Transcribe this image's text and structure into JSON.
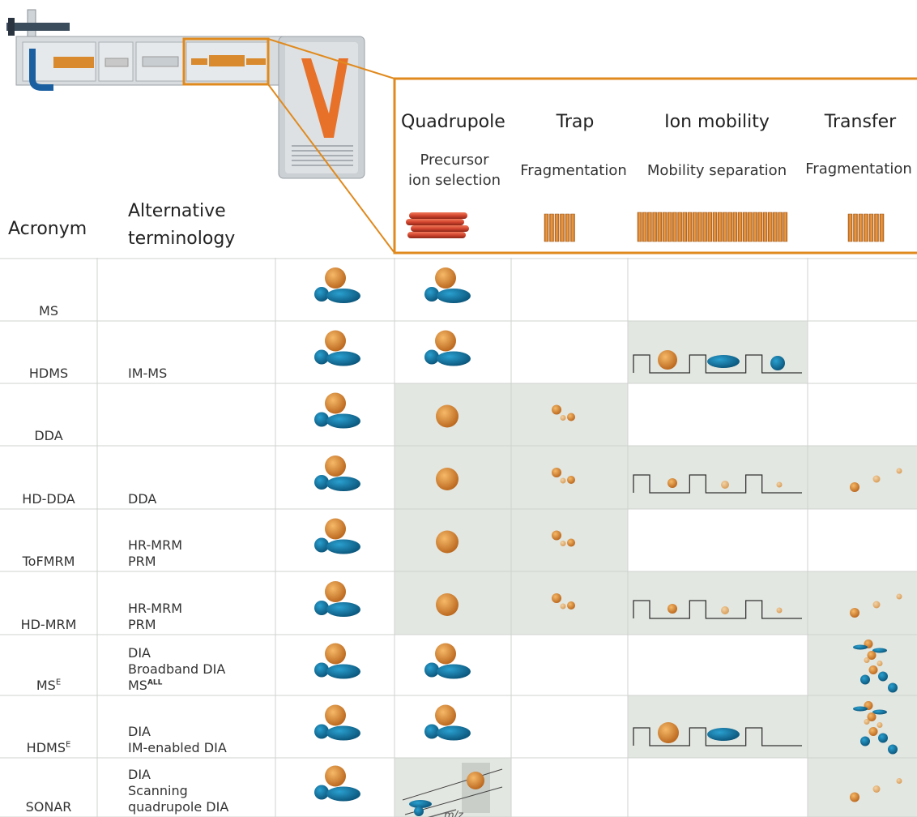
{
  "header": {
    "acronym_label": "Acronym",
    "alt_label_line1": "Alternative",
    "alt_label_line2": "terminology"
  },
  "stages": [
    {
      "title": "Quadrupole",
      "subtitle_line1": "Precursor",
      "subtitle_line2": "ion selection"
    },
    {
      "title": "Trap",
      "subtitle_line1": "Fragmentation",
      "subtitle_line2": ""
    },
    {
      "title": "Ion mobility",
      "subtitle_line1": "Mobility separation",
      "subtitle_line2": ""
    },
    {
      "title": "Transfer",
      "subtitle_line1": "Fragmentation",
      "subtitle_line2": ""
    }
  ],
  "rows": [
    {
      "acronym": "MS",
      "acronym_sup": "",
      "alt_lines": []
    },
    {
      "acronym": "HDMS",
      "acronym_sup": "",
      "alt_lines": [
        "IM-MS"
      ]
    },
    {
      "acronym": "DDA",
      "acronym_sup": "",
      "alt_lines": []
    },
    {
      "acronym": "HD-DDA",
      "acronym_sup": "",
      "alt_lines": [
        "DDA"
      ]
    },
    {
      "acronym": "ToFMRM",
      "acronym_sup": "",
      "alt_lines": [
        "HR-MRM",
        "PRM"
      ]
    },
    {
      "acronym": "HD-MRM",
      "acronym_sup": "",
      "alt_lines": [
        "HR-MRM",
        "PRM"
      ]
    },
    {
      "acronym": "MS",
      "acronym_sup": "E",
      "alt_lines": [
        "DIA",
        "Broadband DIA",
        "MS|ALL"
      ]
    },
    {
      "acronym": "HDMS",
      "acronym_sup": "E",
      "alt_lines": [
        "DIA",
        "IM-enabled DIA"
      ]
    },
    {
      "acronym": "SONAR",
      "acronym_sup": "",
      "alt_lines": [
        "DIA",
        "Scanning",
        "quadrupole DIA"
      ]
    }
  ],
  "sonar_axis_label": "m/z",
  "colors": {
    "orange": "#d9862b",
    "orange_frame": "#e08a1e",
    "blue": "#0d6f9e",
    "shade": "#e3e7e1",
    "grid": "#cfd3cf",
    "rod_red": "#d2452f"
  }
}
